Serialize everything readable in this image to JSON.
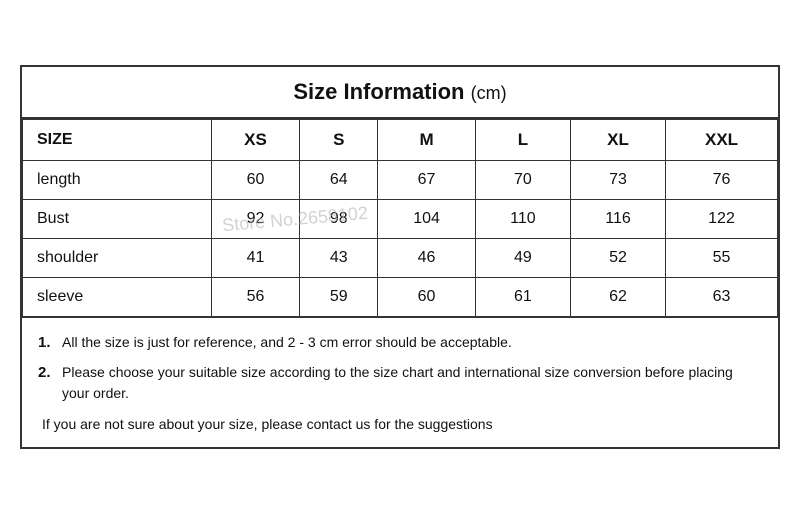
{
  "title": {
    "main": "Size Information",
    "unit": "(cm)"
  },
  "table": {
    "headers": [
      "SIZE",
      "XS",
      "S",
      "M",
      "L",
      "XL",
      "XXL"
    ],
    "rows": [
      {
        "label": "length",
        "values": [
          "60",
          "64",
          "67",
          "70",
          "73",
          "76"
        ]
      },
      {
        "label": "Bust",
        "values": [
          "92",
          "98",
          "104",
          "110",
          "116",
          "122"
        ]
      },
      {
        "label": "shoulder",
        "values": [
          "41",
          "43",
          "46",
          "49",
          "52",
          "55"
        ]
      },
      {
        "label": "sleeve",
        "values": [
          "56",
          "59",
          "60",
          "61",
          "62",
          "63"
        ]
      }
    ]
  },
  "notes": [
    {
      "number": "1.",
      "text": "All the size is just for reference, and 2 - 3 cm error should be acceptable."
    },
    {
      "number": "2.",
      "text": "Please choose your suitable size according to the size chart and international size conversion before placing your order."
    }
  ],
  "extra_note": "If you are not sure about your size, please contact us for the suggestions",
  "watermark": "Store No.2658102"
}
